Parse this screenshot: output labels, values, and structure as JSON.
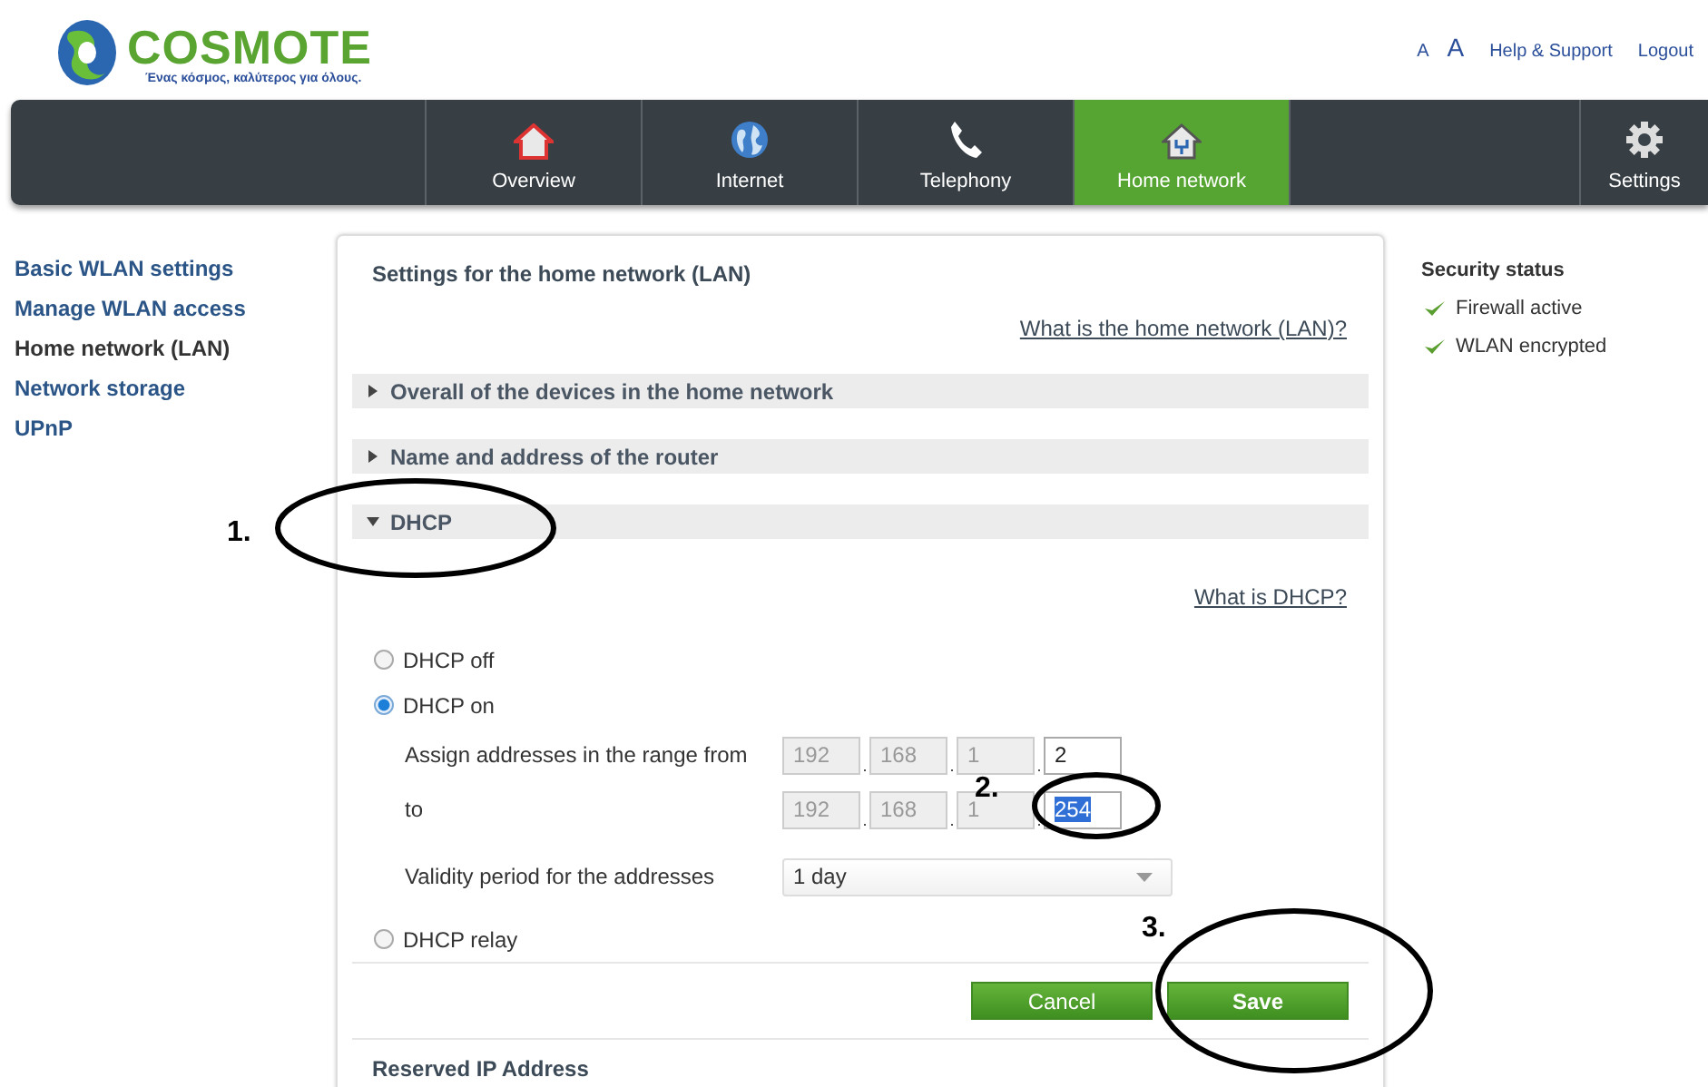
{
  "header": {
    "brand": "COSMOTE",
    "tagline": "Ένας κόσμος, καλύτερος για όλους.",
    "font_small": "A",
    "font_large": "A",
    "links": [
      "Help & Support",
      "Logout"
    ]
  },
  "nav": {
    "tabs": [
      {
        "label": "Overview",
        "kind": "house",
        "selected": false
      },
      {
        "label": "Internet",
        "kind": "globe",
        "selected": false
      },
      {
        "label": "Telephony",
        "kind": "phone",
        "selected": false
      },
      {
        "label": "Home network",
        "kind": "home-network",
        "selected": true
      }
    ],
    "settings": {
      "label": "Settings",
      "kind": "gear",
      "selected": false
    }
  },
  "sidebar": {
    "items": [
      {
        "label": "Basic WLAN settings",
        "selected": false
      },
      {
        "label": "Manage WLAN access",
        "selected": false
      },
      {
        "label": "Home network (LAN)",
        "selected": true
      },
      {
        "label": "Network storage",
        "selected": false
      },
      {
        "label": "UPnP",
        "selected": false
      }
    ]
  },
  "panel": {
    "title": "Settings for the home network (LAN)",
    "help_link": "What is the home network (LAN)?",
    "sections": [
      {
        "label": "Overall of the devices in the home network",
        "expanded": false
      },
      {
        "label": "Name and address of the router",
        "expanded": false
      },
      {
        "label": "DHCP",
        "expanded": true
      }
    ],
    "dhcp": {
      "help_link": "What is DHCP?",
      "options": [
        {
          "label": "DHCP off",
          "selected": false
        },
        {
          "label": "DHCP on",
          "selected": true
        }
      ],
      "ranges": [
        {
          "label": "Assign addresses in the range from",
          "octets": [
            {
              "value": "192",
              "disabled": true
            },
            {
              "separator": ".",
              "value": "168",
              "disabled": true
            },
            {
              "separator": ".",
              "value": "1",
              "disabled": true
            },
            {
              "separator": ".",
              "value": "2",
              "disabled": false,
              "highlighted": false
            }
          ]
        },
        {
          "label": "to",
          "octets": [
            {
              "value": "192",
              "disabled": true
            },
            {
              "separator": ".",
              "value": "168",
              "disabled": true
            },
            {
              "separator": ".",
              "value": "1",
              "disabled": true
            },
            {
              "separator": ".",
              "value": "254",
              "disabled": false,
              "highlighted": true
            }
          ]
        }
      ],
      "validity": {
        "label": "Validity period for the addresses",
        "value": "1 day"
      },
      "relay": {
        "label": "DHCP relay",
        "selected": false
      }
    },
    "buttons": [
      "Cancel",
      "Save"
    ],
    "next_section": "Reserved IP Address"
  },
  "security": {
    "title": "Security status",
    "items": [
      {
        "label": "Firewall active",
        "ok": true
      },
      {
        "label": "WLAN encrypted",
        "ok": true
      }
    ]
  },
  "annotations": [
    "1.",
    "2.",
    "3."
  ]
}
